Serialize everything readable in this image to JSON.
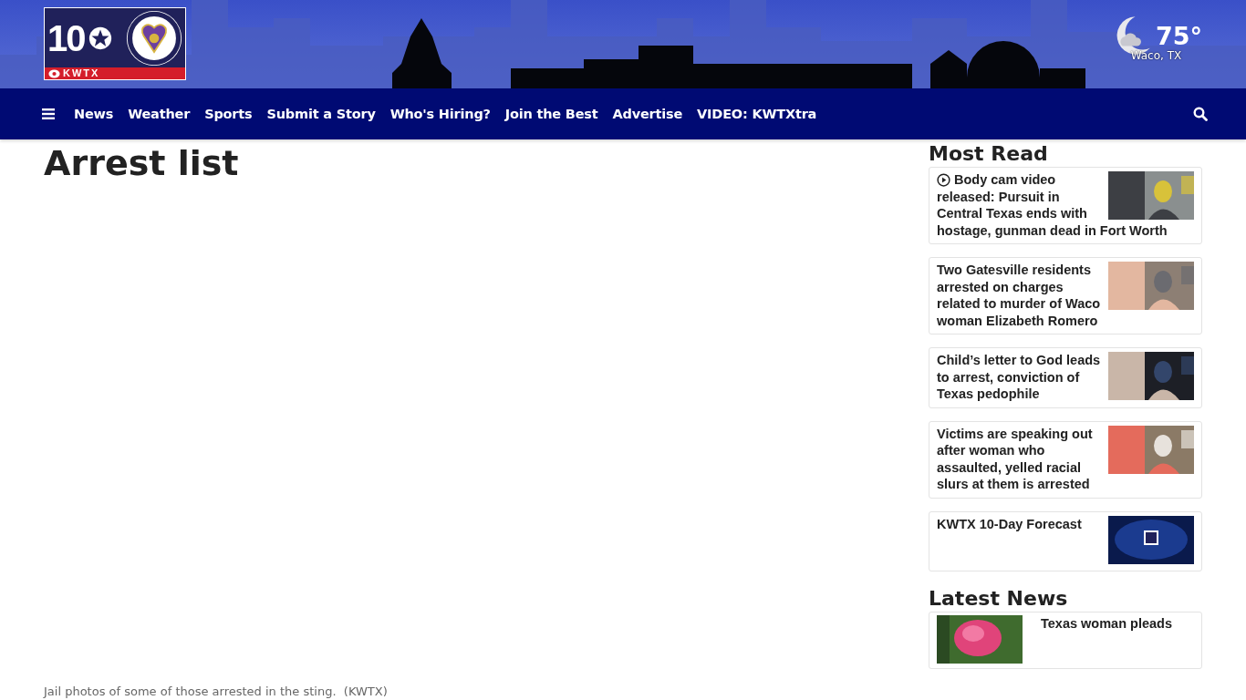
{
  "logo": {
    "number": "10",
    "station": "KWTX"
  },
  "weather": {
    "temperature": "75°",
    "location": "Waco, TX"
  },
  "nav": {
    "items": [
      "News",
      "Weather",
      "Sports",
      "Submit a Story",
      "Who's Hiring?",
      "Join the Best",
      "Advertise",
      "VIDEO: KWTXtra"
    ]
  },
  "article": {
    "title": "Arrest list",
    "caption": "Jail photos of some of those arrested in the sting.",
    "credit": "(KWTX)"
  },
  "most_read": {
    "heading": "Most Read",
    "items": [
      {
        "kind": "video",
        "title": "Body cam video released: Pursuit in Central Texas ends with hostage, gunman dead in Fort Worth"
      },
      {
        "kind": "story",
        "title": "Two Gatesville residents arrested on charges related to murder of Waco woman Elizabeth Romero"
      },
      {
        "kind": "story",
        "title": "Child’s letter to God leads to arrest, conviction of Texas pedophile"
      },
      {
        "kind": "story",
        "title": "Victims are speaking out after woman who assaulted, yelled racial slurs at them is arrested"
      },
      {
        "kind": "forecast",
        "title": "KWTX 10-Day Forecast"
      }
    ]
  },
  "latest_news": {
    "heading": "Latest News",
    "items": [
      {
        "title": "Texas woman pleads"
      }
    ]
  }
}
